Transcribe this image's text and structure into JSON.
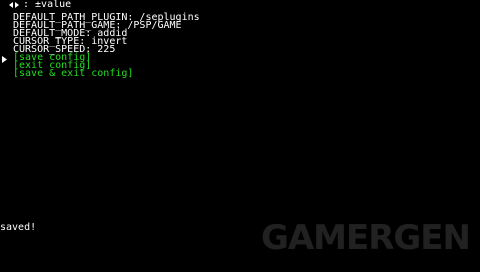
{
  "header": {
    "title": ": ±value",
    "icons": [
      "arrow-left-icon",
      "arrow-right-icon"
    ]
  },
  "menu": {
    "items": [
      {
        "label": "DEFAULT_PATH_PLUGIN: /seplugins",
        "type": "setting"
      },
      {
        "label": "DEFAULT_PATH_GAME: /PSP/GAME",
        "type": "setting"
      },
      {
        "label": "DEFAULT_MODE: addid",
        "type": "setting"
      },
      {
        "label": "CURSOR_TYPE: invert",
        "type": "setting"
      },
      {
        "label": "CURSOR_SPEED: 225",
        "type": "setting"
      },
      {
        "label": "[save config]",
        "type": "action"
      },
      {
        "label": "[exit config]",
        "type": "action"
      },
      {
        "label": "[save & exit config]",
        "type": "action"
      }
    ],
    "selected_index": 5
  },
  "status": {
    "message": "saved!"
  },
  "watermark": {
    "text": "GAMERGEN"
  },
  "colors": {
    "background": "#000000",
    "text": "#ffffff",
    "action": "#22dd22"
  }
}
